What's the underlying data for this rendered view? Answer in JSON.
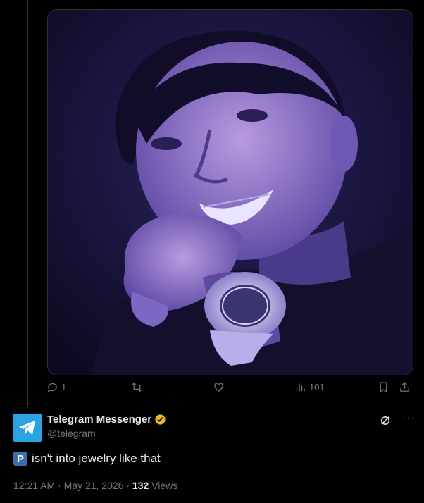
{
  "tweet": {
    "actions": {
      "replies": "1",
      "views": "101"
    },
    "image_alt": "photo"
  },
  "quote": {
    "author_name": "Telegram Messenger",
    "author_handle": "@telegram",
    "text_prefix_emoji": "P",
    "text": "isn't into jewelry like that",
    "time": "12:21 AM",
    "separator": " · ",
    "date": "May 21, 2026",
    "views_count": "132",
    "views_label": "Views"
  },
  "colors": {
    "background": "#000000",
    "muted": "#71767b",
    "text": "#e7e9ea",
    "telegram_blue": "#2aa3e3",
    "verified_gold": "#e8b829"
  },
  "icons": [
    "reply-icon",
    "retweet-icon",
    "like-icon",
    "views-icon",
    "bookmark-icon",
    "share-icon",
    "telegram-logo-icon",
    "verified-badge-icon",
    "grok-icon",
    "more-icon"
  ]
}
